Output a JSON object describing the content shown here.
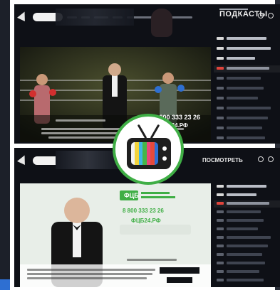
{
  "top_frame": {
    "nav": {
      "brand_label": "ПОДКАСТЫ"
    },
    "ad": {
      "phone": "8 800 333 23 26",
      "site": "ФЦ24.РФ"
    }
  },
  "bottom_frame": {
    "nav": {
      "search_label": "ПОСМОТРЕТЬ"
    },
    "ad": {
      "brand": "ФЦБ",
      "phone": "8 800 333 23 26",
      "site": "ФЦБ24.РФ"
    }
  },
  "overlay": {
    "icon": "retro-tv-icon",
    "ring_color": "#3fae45"
  },
  "colors": {
    "bar_stripes": [
      "#f2f2f2",
      "#f3d43c",
      "#3fb7e6",
      "#45b649",
      "#e9467c",
      "#e64a3b",
      "#2d6fd4"
    ]
  }
}
